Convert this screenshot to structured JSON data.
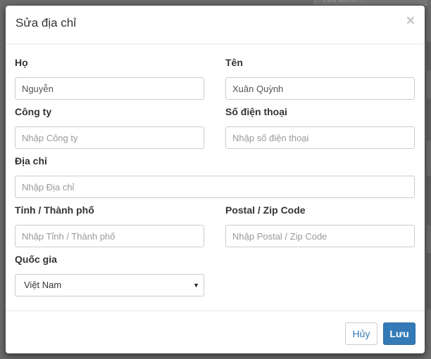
{
  "background": {
    "search_placeholder": "Tìm kiếm ..."
  },
  "modal": {
    "title": "Sửa địa chỉ",
    "close_symbol": "×",
    "fields": {
      "last_name": {
        "label": "Họ",
        "value": "Nguyễn",
        "placeholder": ""
      },
      "first_name": {
        "label": "Tên",
        "value": "Xuân Quỳnh",
        "placeholder": ""
      },
      "company": {
        "label": "Công ty",
        "value": "",
        "placeholder": "Nhập Công ty"
      },
      "phone": {
        "label": "Số điện thoại",
        "value": "",
        "placeholder": "Nhập số điện thoại"
      },
      "address": {
        "label": "Địa chỉ",
        "value": "",
        "placeholder": "Nhập Địa chỉ"
      },
      "city": {
        "label": "Tỉnh / Thành phố",
        "value": "",
        "placeholder": "Nhập Tỉnh / Thành phố"
      },
      "postal": {
        "label": "Postal / Zip Code",
        "value": "",
        "placeholder": "Nhập Postal / Zip Code"
      },
      "country": {
        "label": "Quốc gia",
        "value": "Việt Nam"
      }
    },
    "footer": {
      "cancel_label": "Hủy",
      "save_label": "Lưu"
    }
  },
  "colors": {
    "primary": "#337ab7",
    "overlay": "#6b6b6b"
  },
  "icons": {
    "close": "close-icon",
    "select_arrow": "caret-down-icon"
  }
}
